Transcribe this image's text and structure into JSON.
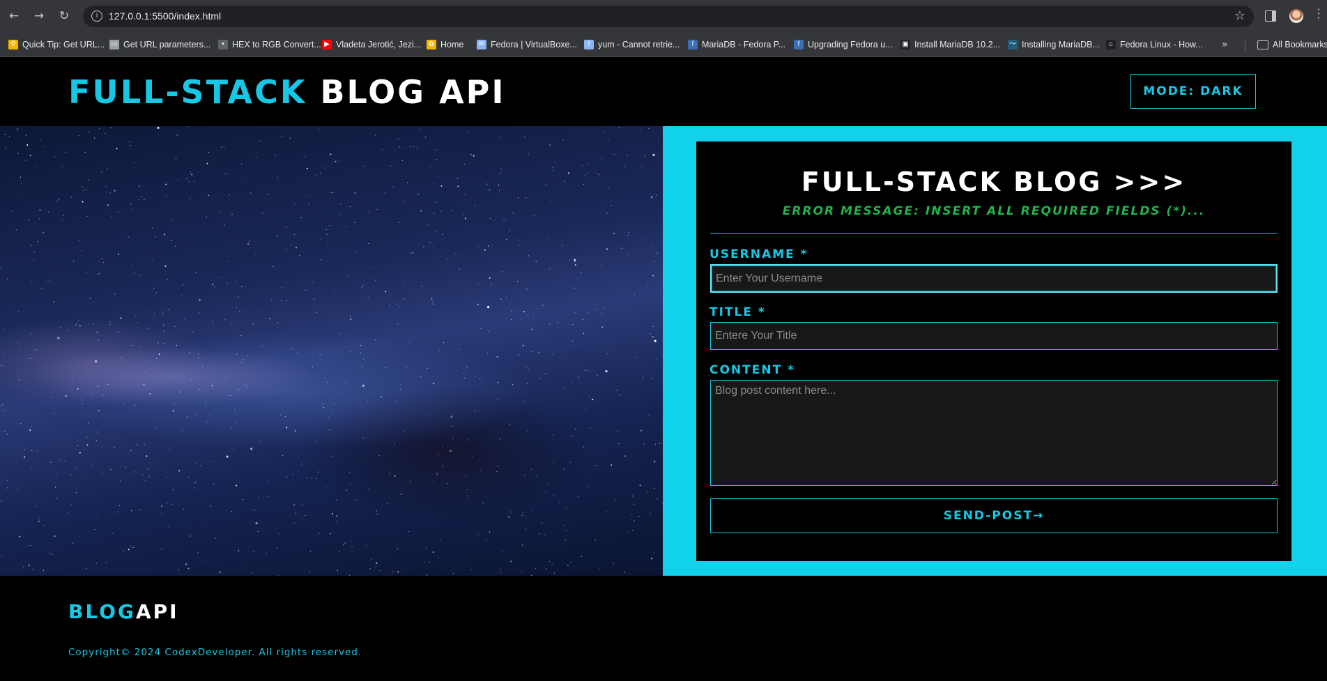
{
  "browser": {
    "url": "127.0.0.1:5500/index.html",
    "bookmarks": [
      {
        "label": "Quick Tip: Get URL...",
        "icon": "link-icon",
        "color": "#f4b400"
      },
      {
        "label": "Get URL parameters...",
        "icon": "laptop-icon",
        "color": "#9aa0a6"
      },
      {
        "label": "HEX to RGB Convert...",
        "icon": "dot-icon",
        "color": "#5f6368"
      },
      {
        "label": "Vladeta Jerotić, Jezi...",
        "icon": "youtube-icon",
        "color": "#ff0000"
      },
      {
        "label": "Home",
        "icon": "home-icon",
        "color": "#f4b400"
      },
      {
        "label": "Fedora | VirtualBoxe...",
        "icon": "mail-icon",
        "color": "#8ab4f8"
      },
      {
        "label": "yum - Cannot retrie...",
        "icon": "fedora-icon",
        "color": "#8ab4f8"
      },
      {
        "label": "MariaDB - Fedora P...",
        "icon": "fedora-icon",
        "color": "#3c6eb4"
      },
      {
        "label": "Upgrading Fedora u...",
        "icon": "fedora-icon",
        "color": "#3c6eb4"
      },
      {
        "label": "Install MariaDB 10.2...",
        "icon": "terminal-icon",
        "color": "#202124"
      },
      {
        "label": "Installing MariaDB...",
        "icon": "mariadb-icon",
        "color": "#1f5f7a"
      },
      {
        "label": "Fedora Linux - How...",
        "icon": "linux-icon",
        "color": "#202124"
      }
    ],
    "all_bookmarks_label": "All Bookmarks"
  },
  "header": {
    "brand_accent": "FULL-STACK",
    "brand_plain": "BLOG API",
    "mode_button": "MODE: DARK"
  },
  "form": {
    "title": "FULL-STACK BLOG >>>",
    "error": "ERROR MESSAGE: INSERT ALL REQUIRED FIELDS (*)...",
    "username_label": "USERNAME *",
    "username_placeholder": "Enter Your Username",
    "username_value": "",
    "title_label": "TITLE *",
    "title_placeholder": "Entere Your Title",
    "title_value": "",
    "content_label": "CONTENT *",
    "content_placeholder": "Blog post content here...",
    "content_value": "",
    "submit_label": "SEND-POST→"
  },
  "footer": {
    "logo_accent": "BLOG",
    "logo_plain": "API",
    "copyright": "Copyright© 2024 CodexDeveloper. All rights reserved."
  },
  "colors": {
    "accent": "#16c8e4",
    "panel": "#12d1eb",
    "error": "#1fb54c",
    "background": "#000000"
  }
}
